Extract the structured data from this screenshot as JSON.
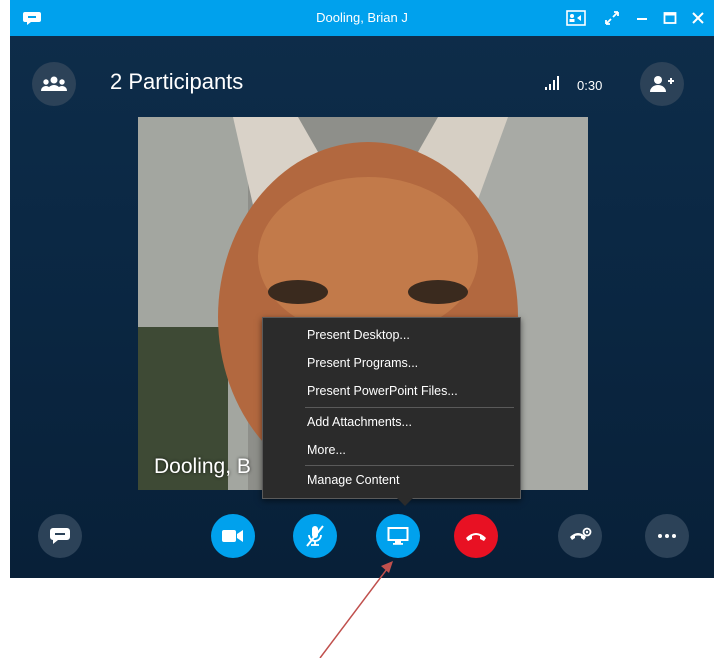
{
  "window": {
    "title": "Dooling, Brian J"
  },
  "header": {
    "participants_label": "2 Participants",
    "call_timer": "0:30"
  },
  "video": {
    "caller_name": "Dooling, B"
  },
  "present_menu": {
    "items": [
      {
        "label": "Present Desktop..."
      },
      {
        "label": "Present Programs..."
      },
      {
        "label": "Present PowerPoint Files..."
      },
      {
        "label": "Add Attachments..."
      },
      {
        "label": "More..."
      },
      {
        "label": "Manage Content"
      }
    ]
  },
  "controls": {
    "buttons": [
      {
        "icon": "chat-icon"
      },
      {
        "icon": "video-camera-icon"
      },
      {
        "icon": "mic-muted-icon"
      },
      {
        "icon": "present-screen-icon"
      },
      {
        "icon": "hang-up-icon"
      },
      {
        "icon": "call-controls-icon"
      },
      {
        "icon": "more-options-icon"
      }
    ]
  },
  "colors": {
    "title_bar": "#00a1ed",
    "window_bg": "#0b2844",
    "active_button": "#00a1ed",
    "hang_up": "#e81123",
    "menu_bg": "#2b2b2b",
    "annotation_arrow": "#c0504d"
  }
}
